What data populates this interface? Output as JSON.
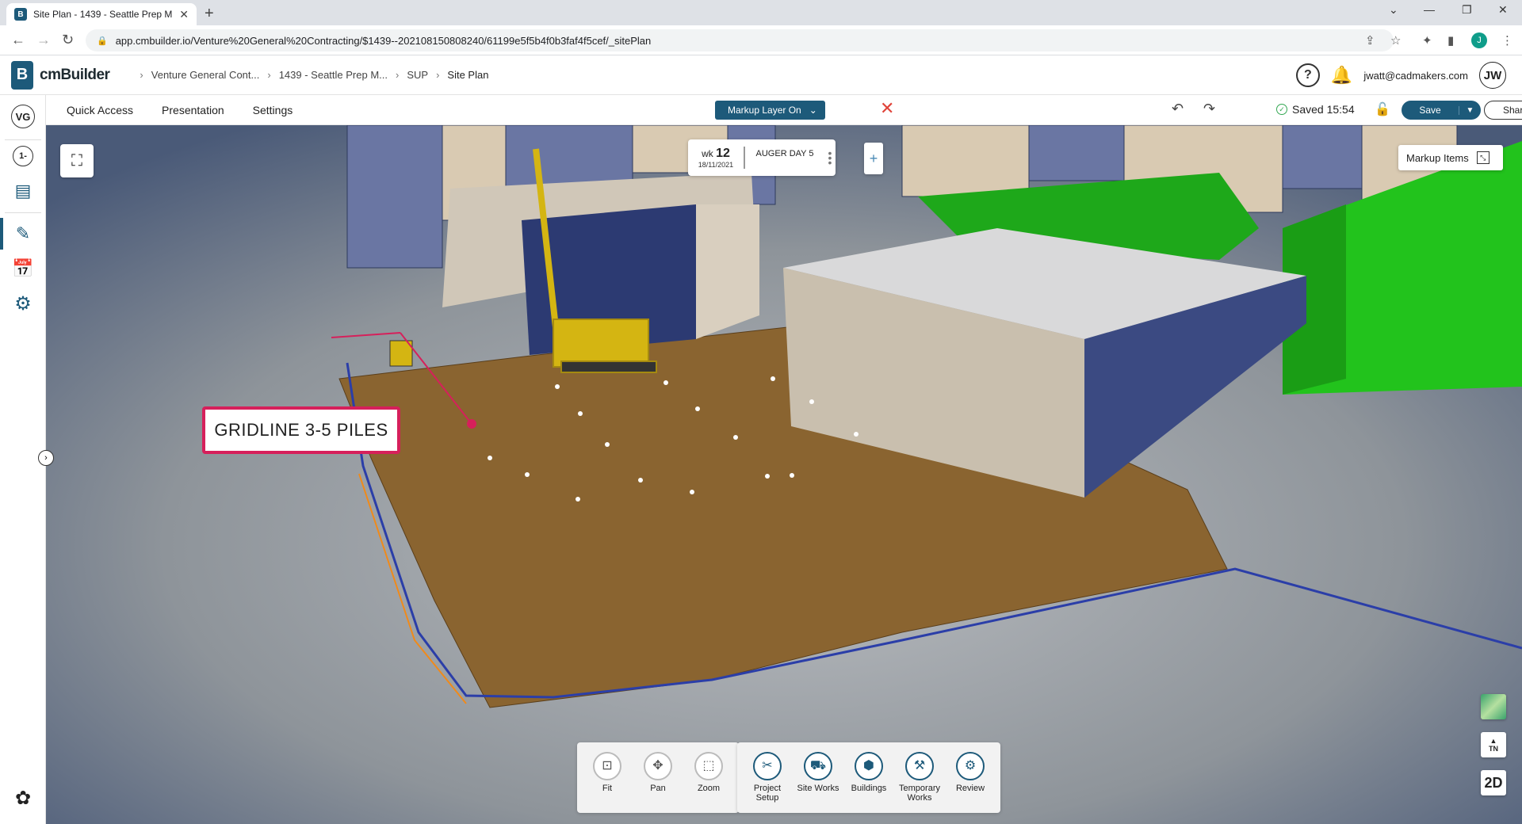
{
  "browser": {
    "tab_title": "Site Plan - 1439 - Seattle Prep M",
    "url": "app.cmbuilder.io/Venture%20General%20Contracting/$1439--202108150808240/61199e5f5b4f0b3faf4f5cef/_sitePlan",
    "profile_initial": "J"
  },
  "app": {
    "logo_letter": "B",
    "name": "cmBuilder",
    "breadcrumb": [
      "Venture General Cont...",
      "1439 - Seattle Prep M...",
      "SUP",
      "Site Plan"
    ],
    "help_label": "?",
    "user_email": "jwatt@cadmakers.com",
    "user_initials": "JW"
  },
  "sidebar": {
    "company_initials": "VG",
    "level_label": "1-"
  },
  "toolbar": {
    "menus": [
      "Quick Access",
      "Presentation",
      "Settings"
    ],
    "markup_layer": "Markup Layer On",
    "saved_text": "Saved 15:54",
    "save_label": "Save",
    "share_label": "Share"
  },
  "timeline": {
    "wk_prefix": "wk",
    "week": "12",
    "date": "18/11/2021",
    "label": "AUGER DAY 5"
  },
  "markup_items_label": "Markup Items",
  "callout_text": "GRIDLINE 3-5 PILES",
  "bottom_tools_left": [
    {
      "label": "Fit",
      "icon": "fit-icon"
    },
    {
      "label": "Pan",
      "icon": "pan-icon"
    },
    {
      "label": "Zoom",
      "icon": "zoom-icon"
    }
  ],
  "bottom_tools_right": [
    {
      "label": "Project Setup",
      "icon": "project-setup-icon"
    },
    {
      "label": "Site Works",
      "icon": "site-works-icon"
    },
    {
      "label": "Buildings",
      "icon": "buildings-icon"
    },
    {
      "label": "Temporary Works",
      "icon": "temporary-works-icon"
    },
    {
      "label": "Review",
      "icon": "review-icon"
    }
  ],
  "right_controls": {
    "north_label": "TN",
    "view_mode": "2D"
  },
  "colors": {
    "brand": "#1d5a7a",
    "callout_border": "#d6205b",
    "site_ground": "#8a6430",
    "green_buildings": "#22c31c"
  }
}
